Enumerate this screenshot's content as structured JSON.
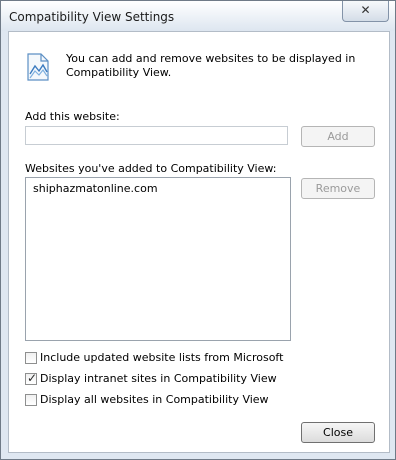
{
  "window": {
    "title": "Compatibility View Settings",
    "close_glyph": "✕"
  },
  "info": {
    "text": "You can add and remove websites to be displayed in Compatibility View.",
    "icon": "compatibility-view-icon"
  },
  "add_section": {
    "label": "Add this website:",
    "input_value": "",
    "add_button": "Add"
  },
  "list_section": {
    "label": "Websites you've added to Compatibility View:",
    "items": [
      "shiphazmatonline.com"
    ],
    "remove_button": "Remove"
  },
  "options": [
    {
      "label": "Include updated website lists from Microsoft",
      "checked": false
    },
    {
      "label": "Display intranet sites in Compatibility View",
      "checked": true
    },
    {
      "label": "Display all websites in Compatibility View",
      "checked": false
    }
  ],
  "footer": {
    "close_button": "Close"
  },
  "colors": {
    "frame": "#dfe7f1",
    "client_bg": "#ffffff"
  }
}
